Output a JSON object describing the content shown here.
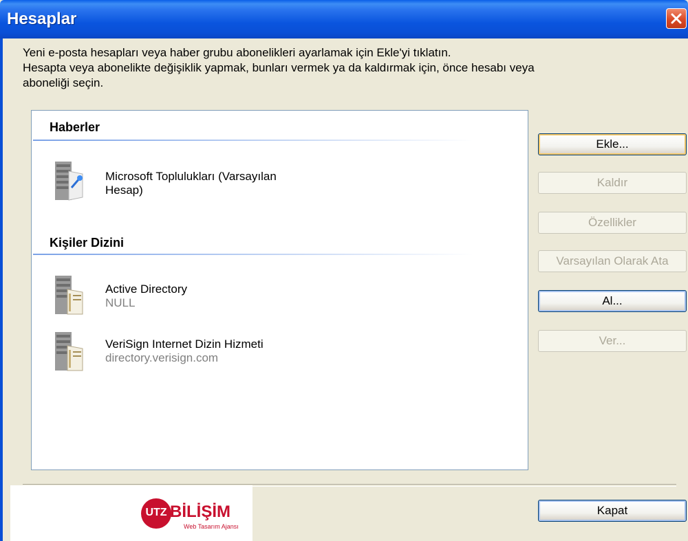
{
  "window": {
    "title": "Hesaplar",
    "close_icon": "close-icon"
  },
  "description": {
    "line1": "Yeni e-posta hesapları veya haber grubu abonelikleri ayarlamak için Ekle'yi tıklatın.",
    "line2": "Hesapta veya abonelikte değişiklik yapmak, bunları vermek ya da kaldırmak için, önce hesabı veya",
    "line3": "aboneliği seçin."
  },
  "groups": [
    {
      "title": "Haberler",
      "items": [
        {
          "name_line1": "Microsoft Toplulukları (Varsayılan",
          "name_line2": "Hesap)",
          "icon": "news-server-icon"
        }
      ]
    },
    {
      "title": "Kişiler Dizini",
      "items": [
        {
          "name": "Active Directory",
          "sub": "NULL",
          "icon": "directory-server-icon"
        },
        {
          "name": "VeriSign Internet Dizin Hizmeti",
          "sub": "directory.verisign.com",
          "icon": "directory-server-icon"
        }
      ]
    }
  ],
  "buttons": {
    "add": "Ekle...",
    "remove": "Kaldır",
    "properties": "Özellikler",
    "set_default": "Varsayılan Olarak Ata",
    "import": "Al...",
    "export": "Ver...",
    "close": "Kapat"
  },
  "logo": {
    "badge": "UTZ",
    "name": "BİLİŞİM",
    "tagline": "Web Tasarım Ajansı"
  },
  "colors": {
    "title_bar": "#0A55DE",
    "window_bg": "#ECE9D8",
    "logo_red": "#C8102E"
  }
}
